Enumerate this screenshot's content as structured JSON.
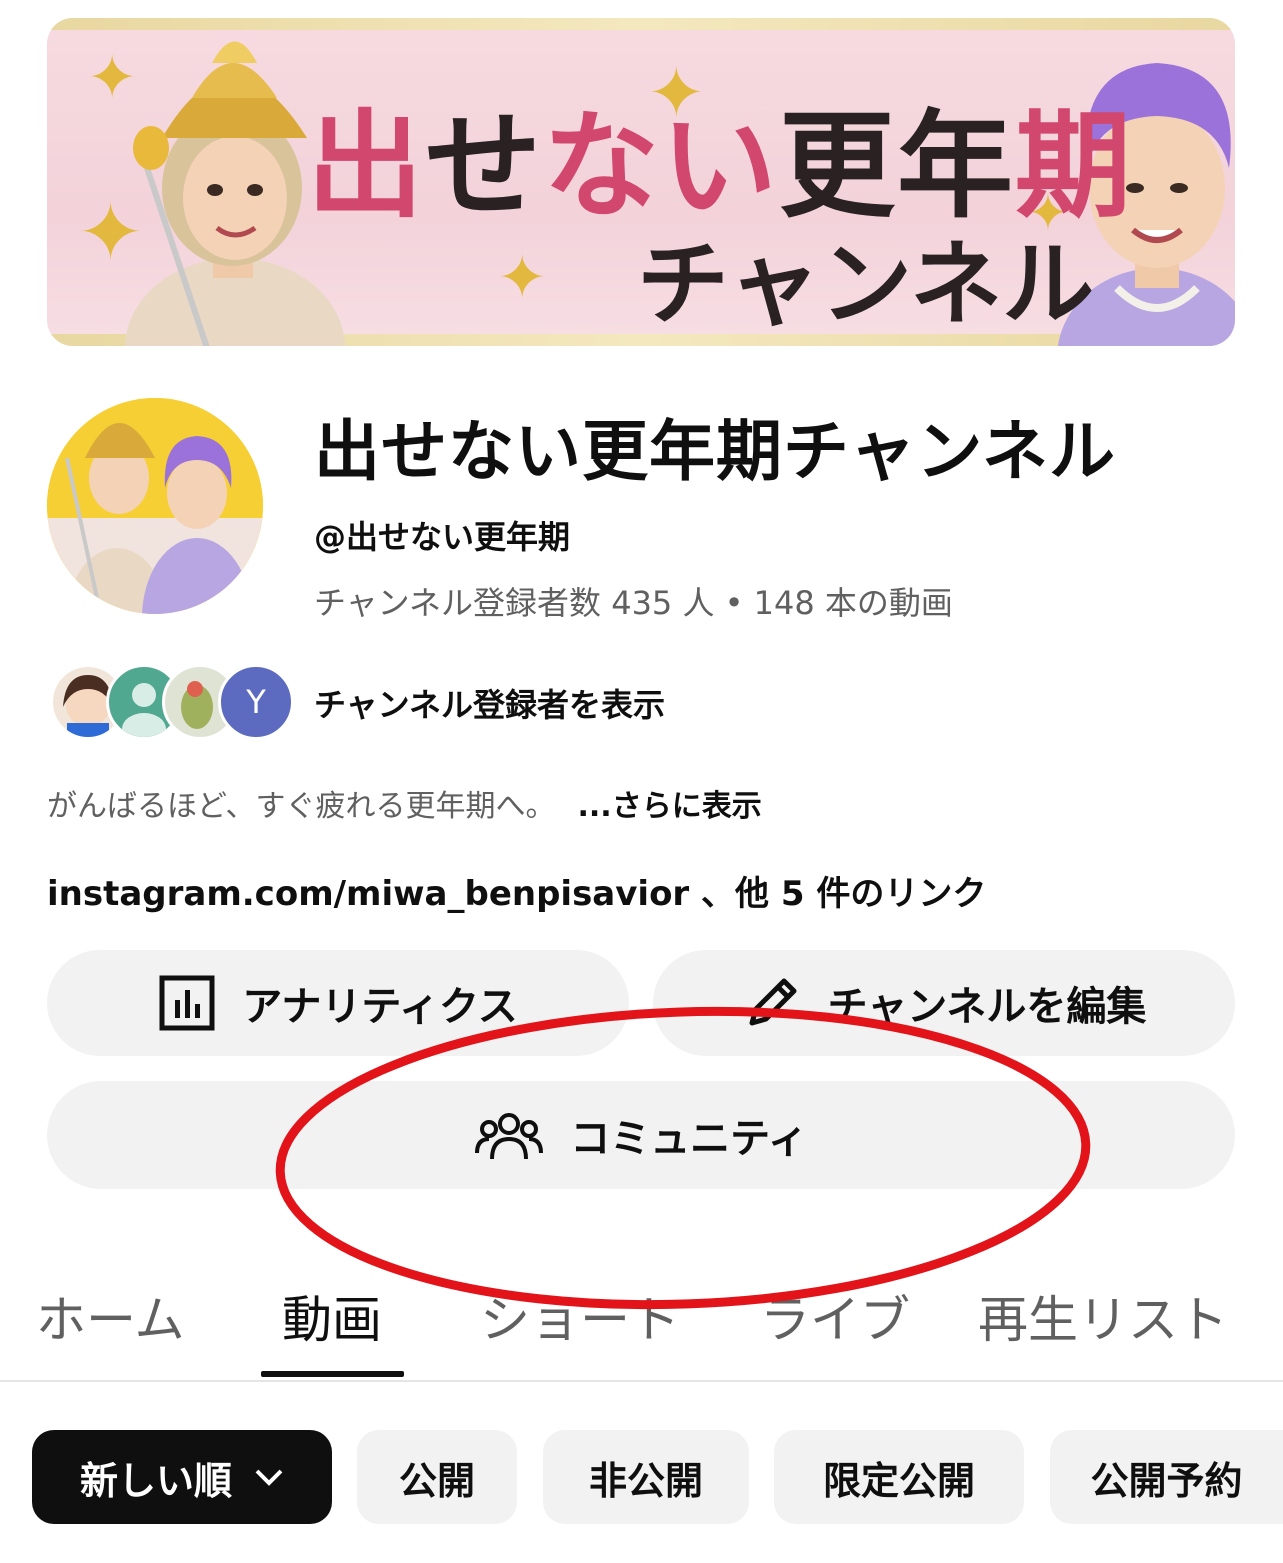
{
  "banner": {
    "title_pink_1": "出",
    "title_dark_1": "せ",
    "title_pink_2": "ない",
    "title_dark_2": "更年",
    "title_pink_3": "期",
    "title_line2": "チャンネル"
  },
  "channel": {
    "name": "出せない更年期チャンネル",
    "handle": "@出せない更年期",
    "stats": "チャンネル登録者数 435 人 • 148 本の動画",
    "subscribers_link": "チャンネル登録者を表示",
    "subscriber_initial": "Y",
    "description": "がんばるほど、すぐ疲れる更年期へ。",
    "more": "...さらに表示",
    "links": "instagram.com/miwa_benpisavior 、他 5 件のリンク"
  },
  "actions": {
    "analytics": "アナリティクス",
    "edit": "チャンネルを編集",
    "community": "コミュニティ"
  },
  "tabs": [
    {
      "label": "ホーム"
    },
    {
      "label": "動画"
    },
    {
      "label": "ショート"
    },
    {
      "label": "ライブ"
    },
    {
      "label": "再生リスト"
    }
  ],
  "active_tab": "動画",
  "filters": {
    "sort": "新しい順",
    "chips": [
      "公開",
      "非公開",
      "限定公開",
      "公開予約"
    ]
  },
  "colors": {
    "annotation": "#e3131a",
    "chip_selected": "#0f0f0f",
    "banner_pink": "#d2476d"
  },
  "icons": {
    "analytics": "bar-chart-icon",
    "edit": "pencil-icon",
    "community": "people-icon",
    "sort": "chevron-down-icon"
  }
}
